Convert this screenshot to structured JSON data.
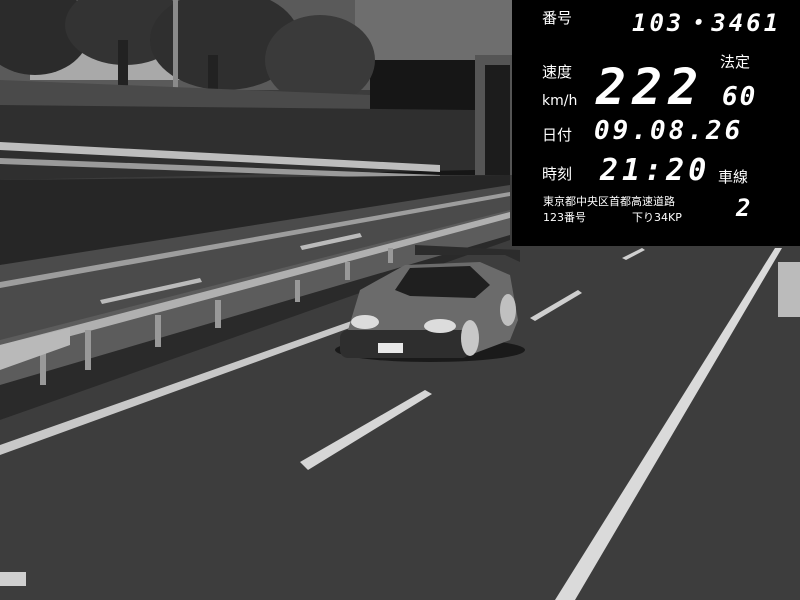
{
  "hud": {
    "plate_label": "番号",
    "plate_number": "103・3461",
    "speed_label": "速度",
    "speed_unit": "km/h",
    "speed_value": "222",
    "limit_label": "法定",
    "limit_value": "60",
    "date_label": "日付",
    "date_value": "09.08.26",
    "time_label": "時刻",
    "time_value": "21:20",
    "lane_label": "車線",
    "lane_value": "2",
    "road_name": "東京都中央区首都高速道路",
    "route_number": "123番号",
    "direction_kp": "下り34KP"
  },
  "colors": {
    "hud_background": "#000000",
    "hud_text": "#ffffff"
  }
}
